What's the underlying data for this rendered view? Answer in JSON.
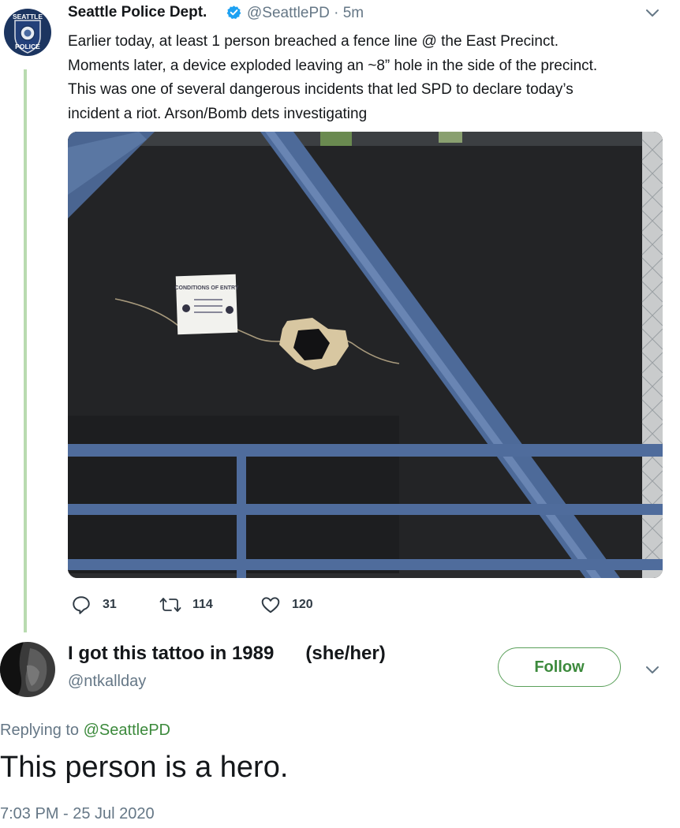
{
  "tweet": {
    "author_name": "Seattle Police Dept.",
    "handle": "@SeattlePD",
    "separator": "·",
    "time_ago": "5m",
    "avatar_text_top": "SEATTLE",
    "avatar_text_bottom": "POLICE",
    "text_lines": [
      "Earlier today, at least 1 person breached a fence line @ the East Precinct.",
      "Moments later, a device exploded leaving an ~8” hole in the side of the precinct.",
      "This was one of several dangerous incidents that led SPD to declare today’s",
      "incident a riot. Arson/Bomb dets investigating"
    ],
    "photo_sign_text": "CONDITIONS OF ENTRY",
    "reply_count": "31",
    "retweet_count": "114",
    "like_count": "120"
  },
  "reply": {
    "display_name": "I got this tattoo in 1989      (she/her)",
    "handle": "@ntkallday",
    "follow_label": "Follow",
    "replying_prefix": "Replying to",
    "replying_to": "@SeattlePD",
    "text": "This person is a hero.",
    "timestamp": "7:03 PM - 25 Jul 2020"
  },
  "colors": {
    "thread_line": "#b9dbb0",
    "accent_green": "#3c8a3c",
    "muted_gray": "#657786",
    "verified_blue": "#1da1f2"
  },
  "icons": [
    "verified-badge-icon",
    "chevron-down-icon",
    "reply-icon",
    "retweet-icon",
    "like-icon"
  ]
}
